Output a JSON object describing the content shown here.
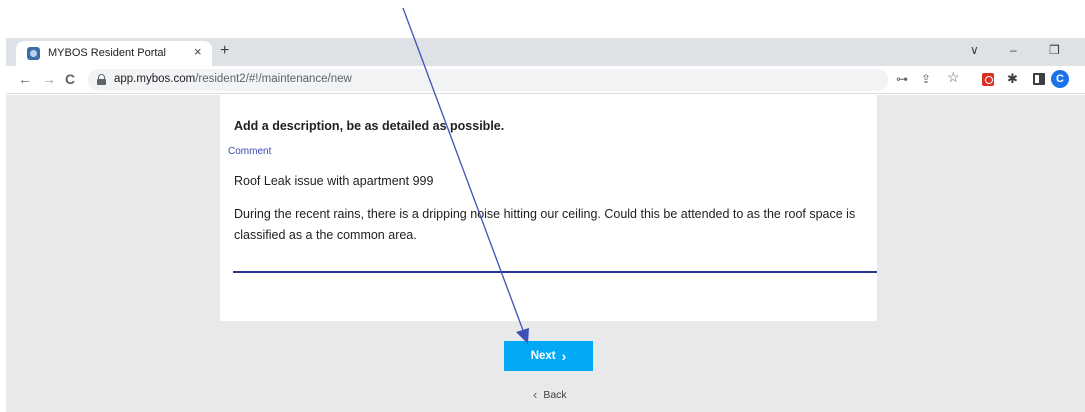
{
  "browser": {
    "tab": {
      "title": "MYBOS Resident Portal",
      "close_icon": "×",
      "favicon": "mybos-favicon"
    },
    "new_tab_icon": "+",
    "window_controls": {
      "dropdown": "∨",
      "minimize": "–",
      "restore": "❐"
    },
    "nav": {
      "back": "←",
      "forward": "→",
      "reload": "C"
    },
    "url": {
      "host": "app.mybos.com",
      "path": "/resident2/#!/maintenance/new"
    },
    "toolbar_icons": {
      "key": "⊶",
      "share": "⇪",
      "bookmark": "☆",
      "extensions": "✱"
    },
    "profile_initial": "C"
  },
  "form": {
    "heading": "Add a description, be as detailed as possible.",
    "comment_label": "Comment",
    "comment_lines": [
      "Roof Leak issue with apartment 999",
      "During the recent rains, there is a dripping noise hitting our ceiling.  Could this be attended to as the roof space is classified as a the common area."
    ],
    "next_label": "Next",
    "next_icon": "›",
    "back_label": "Back",
    "back_icon": "‹"
  },
  "colors": {
    "accent": "#03a9f4",
    "label": "#3949ab",
    "underline": "#283593",
    "annotation": "#3f51b5",
    "page_bg": "#e8e9eb"
  }
}
